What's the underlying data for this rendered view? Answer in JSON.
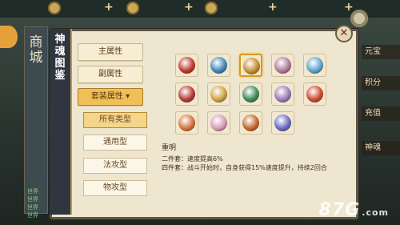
{
  "app": {
    "panel_title": "神魂图鉴",
    "close_symbol": "✕"
  },
  "left_strip": {
    "shop_label": "商城",
    "rows": [
      "世界",
      "世界",
      "世界",
      "世界"
    ]
  },
  "right_labels": [
    "元宝",
    "积分",
    "充值",
    "神魂"
  ],
  "tabs": [
    {
      "label": "主属性",
      "active": false
    },
    {
      "label": "副属性",
      "active": false
    },
    {
      "label": "套装属性 ▾",
      "active": true
    }
  ],
  "filters": [
    {
      "label": "所有类型",
      "active": true
    },
    {
      "label": "通用型",
      "active": false
    },
    {
      "label": "法攻型",
      "active": false
    },
    {
      "label": "物攻型",
      "active": false
    }
  ],
  "soul_icons": [
    {
      "name": "red-beast-icon",
      "color": "#c0392b",
      "selected": false
    },
    {
      "name": "blue-dragon-icon",
      "color": "#3f86b8",
      "selected": false
    },
    {
      "name": "golden-lion-icon",
      "color": "#c58b2c",
      "selected": true
    },
    {
      "name": "white-wing-icon",
      "color": "#b07a9a",
      "selected": false
    },
    {
      "name": "ice-dragon-icon",
      "color": "#5aa6cf",
      "selected": false
    },
    {
      "name": "crimson-bird-icon",
      "color": "#b23a32",
      "selected": false
    },
    {
      "name": "gold-wing-icon",
      "color": "#d0a040",
      "selected": false
    },
    {
      "name": "green-serpent-icon",
      "color": "#3d8a5a",
      "selected": false
    },
    {
      "name": "violet-fox-icon",
      "color": "#9a7ab8",
      "selected": false
    },
    {
      "name": "red-fox-icon",
      "color": "#cc4a2e",
      "selected": false
    },
    {
      "name": "white-tiger-icon",
      "color": "#d0743a",
      "selected": false
    },
    {
      "name": "pink-deer-icon",
      "color": "#d79ab8",
      "selected": false
    },
    {
      "name": "sun-spirit-icon",
      "color": "#c2682a",
      "selected": false
    },
    {
      "name": "blue-crane-icon",
      "color": "#6a6ac8",
      "selected": false
    }
  ],
  "description": {
    "name": "重明",
    "line1": "二件套：速度提高6%",
    "line2": "四件套：战斗开始时，自身获得15%速度提升，持续2回合"
  },
  "watermark": {
    "text": "87G",
    "suffix": ".com"
  }
}
